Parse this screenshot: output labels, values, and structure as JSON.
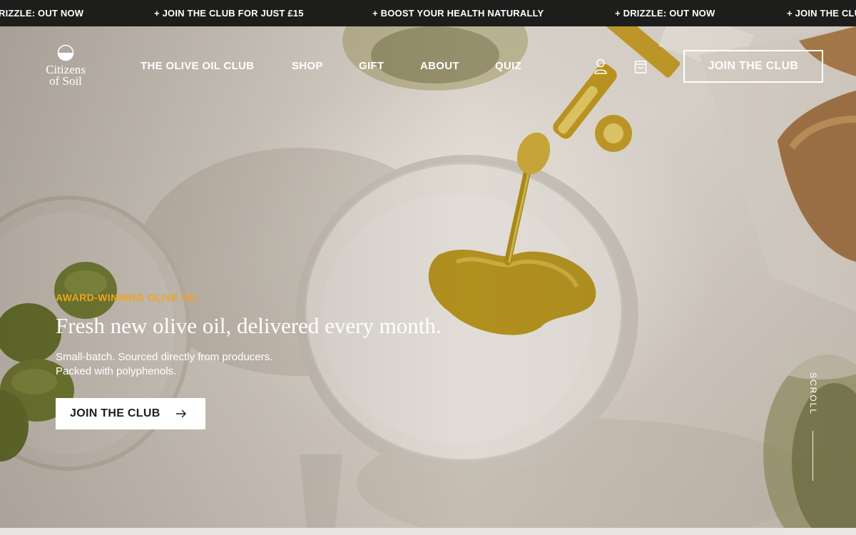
{
  "ticker": {
    "items": [
      "RIZZLE: OUT NOW",
      "+ JOIN THE CLUB FOR JUST £15",
      "+ BOOST YOUR HEALTH NATURALLY",
      "+ DRIZZLE: OUT NOW",
      "+ JOIN THE CLU"
    ]
  },
  "brand": {
    "logo_text": "Citizens\nof Soil",
    "logo_icon": "half-filled-circle-icon"
  },
  "nav": {
    "items": [
      {
        "label": "THE OLIVE OIL CLUB"
      },
      {
        "label": "SHOP"
      },
      {
        "label": "GIFT"
      },
      {
        "label": "ABOUT"
      },
      {
        "label": "QUIZ"
      }
    ],
    "account_icon": "user-icon",
    "cart_icon": "shopping-bag-icon",
    "cta_label": "JOIN THE CLUB"
  },
  "hero": {
    "eyebrow": "AWARD-WINNING OLIVE OIL",
    "headline": "Fresh new olive oil, delivered every month.",
    "subcopy": [
      "Small-batch. Sourced directly from producers.",
      "Packed with polyphenols."
    ],
    "cta_label": "JOIN THE CLUB",
    "cta_icon": "arrow-right-icon",
    "scroll_label": "SCROLL"
  },
  "colors": {
    "ticker_bg": "#1d1d1b",
    "accent": "#f0a51d",
    "text_light": "#ffffff",
    "text_dark": "#1d1d1b",
    "olive_oil": "#b8961f"
  }
}
